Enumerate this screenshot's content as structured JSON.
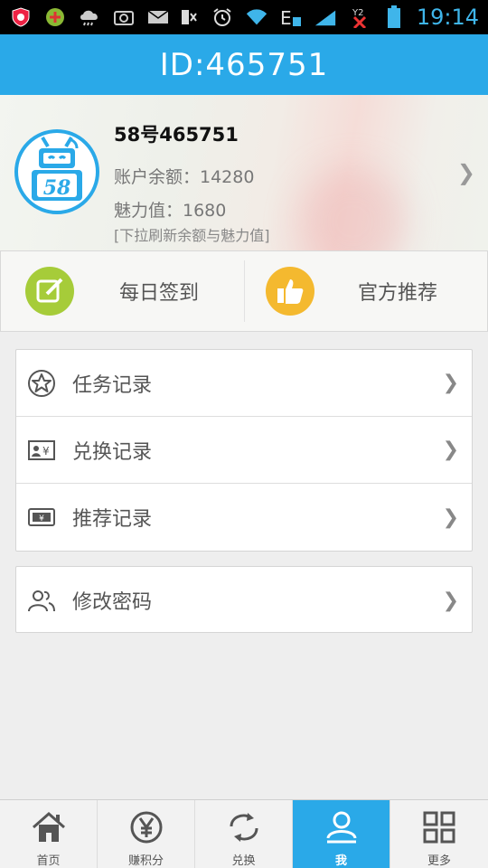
{
  "status_bar": {
    "time": "19:14",
    "icons": [
      "shield-icon",
      "plus-circle-icon",
      "cloud-icon",
      "camera-icon",
      "mail-icon",
      "vibrate-icon",
      "alarm-icon",
      "wifi-icon",
      "data-e-icon",
      "signal-1-icon",
      "signal-2-icon",
      "battery-icon"
    ]
  },
  "header": {
    "title": "ID:465751"
  },
  "profile": {
    "avatar_text": "58",
    "name": "58号465751",
    "balance": "账户余额：14280",
    "charm": "魅力值：1680",
    "hint": "[下拉刷新余额与魅力值]"
  },
  "actions": [
    {
      "label": "每日签到",
      "icon": "edit-icon",
      "color": "#a6cc39"
    },
    {
      "label": "官方推荐",
      "icon": "thumbs-up-icon",
      "color": "#f4b92f"
    }
  ],
  "menu_group_1": [
    {
      "label": "任务记录",
      "icon": "star-icon"
    },
    {
      "label": "兑换记录",
      "icon": "yen-card-icon"
    },
    {
      "label": "推荐记录",
      "icon": "ticket-icon"
    }
  ],
  "menu_group_2": [
    {
      "label": "修改密码",
      "icon": "users-icon"
    }
  ],
  "chevron": "❯",
  "bottom_nav": [
    {
      "label": "首页",
      "icon": "home-icon",
      "active": false
    },
    {
      "label": "赚积分",
      "icon": "yen-circle-icon",
      "active": false
    },
    {
      "label": "兑换",
      "icon": "refresh-icon",
      "active": false
    },
    {
      "label": "我",
      "icon": "user-icon",
      "active": true
    },
    {
      "label": "更多",
      "icon": "grid-icon",
      "active": false
    }
  ],
  "colors": {
    "accent": "#2aa9e8",
    "checkin_green": "#a6cc39",
    "recommend_orange": "#f4b92f"
  }
}
